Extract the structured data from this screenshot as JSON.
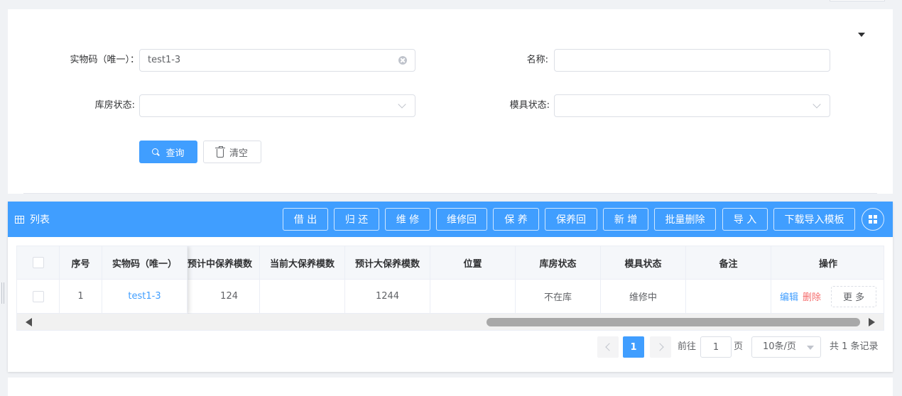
{
  "search": {
    "fields": [
      {
        "label": "实物码（唯一）：",
        "value": "test1-3",
        "placeholder": ""
      },
      {
        "label": "名称:",
        "value": "",
        "placeholder": ""
      },
      {
        "label": "库房状态:",
        "value": "",
        "placeholder": ""
      },
      {
        "label": "模具状态:",
        "value": "",
        "placeholder": ""
      }
    ],
    "query_label": "查询",
    "clear_label": "清空"
  },
  "list": {
    "title": "列表",
    "toolbar": [
      "借 出",
      "归 还",
      "维 修",
      "维修回",
      "保 养",
      "保养回",
      "新 增",
      "批量删除",
      "导 入",
      "下载导入模板"
    ]
  },
  "table": {
    "columns": [
      "序号",
      "实物码（唯一）",
      "预计中保养模数",
      "当前大保养模数",
      "预计大保养模数",
      "位置",
      "库房状态",
      "模具状态",
      "备注",
      "操作"
    ],
    "rows": [
      {
        "index": "1",
        "code": "test1-3",
        "expected_mid_maintenance": "124",
        "current_major_maintenance": "",
        "expected_major_maintenance": "1244",
        "location": "",
        "warehouse_status": "不在库",
        "mold_status": "维修中",
        "remark": "",
        "actions": {
          "edit": "编辑",
          "delete": "删除",
          "more": "更 多"
        }
      }
    ]
  },
  "pagination": {
    "current_page": "1",
    "goto_prefix": "前往",
    "goto_value": "1",
    "goto_suffix": "页",
    "page_size": "10条/页",
    "total_text": "共 1 条记录"
  },
  "colors": {
    "primary": "#409eff",
    "danger": "#f56c6c",
    "background": "#f0f2f5"
  }
}
